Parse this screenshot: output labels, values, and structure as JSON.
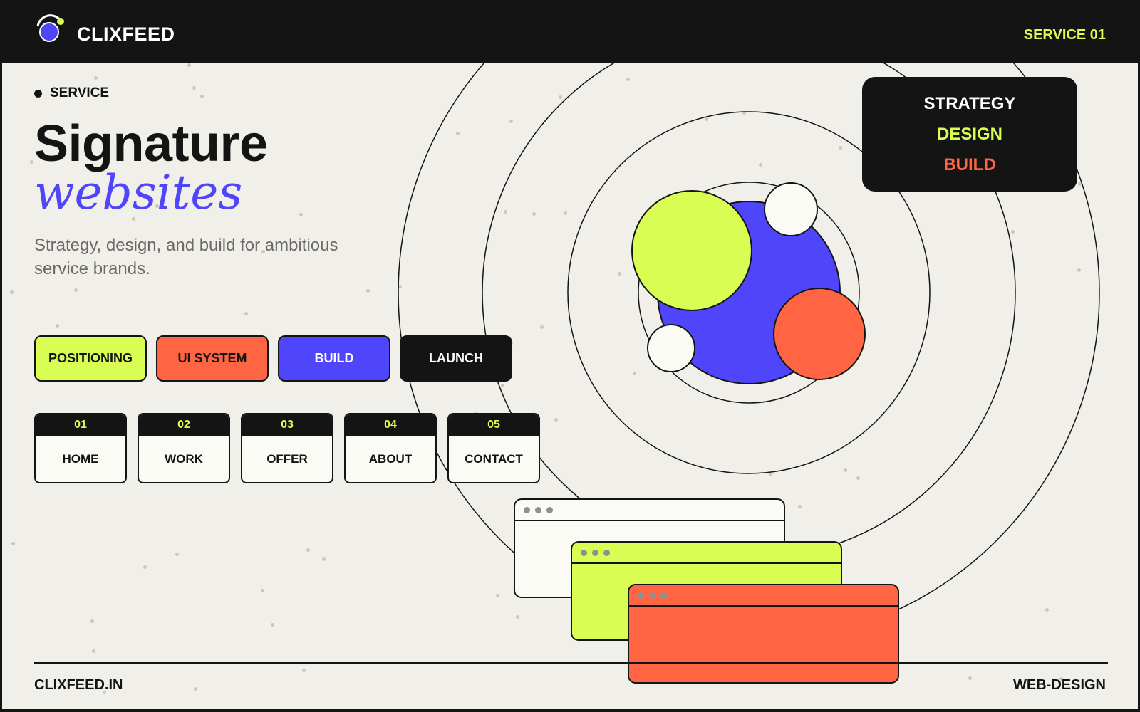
{
  "header": {
    "brand": "CLIXFEED",
    "service_number": "SERVICE 01"
  },
  "hero": {
    "eyebrow": "SERVICE",
    "headline": "Signature",
    "headline_italic": "websites",
    "subcopy": "Strategy, design, and build for ambitious service brands."
  },
  "chips": [
    {
      "label": "POSITIONING",
      "bg": "#d9fd52",
      "fg": "#141414"
    },
    {
      "label": "UI SYSTEM",
      "bg": "#ff6542",
      "fg": "#141414"
    },
    {
      "label": "BUILD",
      "bg": "#4f46fb",
      "fg": "#ffffff"
    },
    {
      "label": "LAUNCH",
      "bg": "#141414",
      "fg": "#ffffff"
    }
  ],
  "nav": [
    {
      "num": "01",
      "label": "HOME"
    },
    {
      "num": "02",
      "label": "WORK"
    },
    {
      "num": "03",
      "label": "OFFER"
    },
    {
      "num": "04",
      "label": "ABOUT"
    },
    {
      "num": "05",
      "label": "CONTACT"
    }
  ],
  "stack": {
    "line1": "STRATEGY",
    "line1_color": "#ffffff",
    "line2": "DESIGN",
    "line2_color": "#d9fd52",
    "line3": "BUILD",
    "line3_color": "#ff6542"
  },
  "windows": [
    {
      "color": "#fbfbf6"
    },
    {
      "color": "#d9fd52"
    },
    {
      "color": "#ff6542"
    }
  ],
  "footer": {
    "domain": "CLIXFEED.IN",
    "tag": "WEB-DESIGN"
  },
  "colors": {
    "ink": "#141414",
    "paper": "#f0efe9",
    "lime": "#d9fd52",
    "coral": "#ff6542",
    "violet": "#4f46fb"
  }
}
